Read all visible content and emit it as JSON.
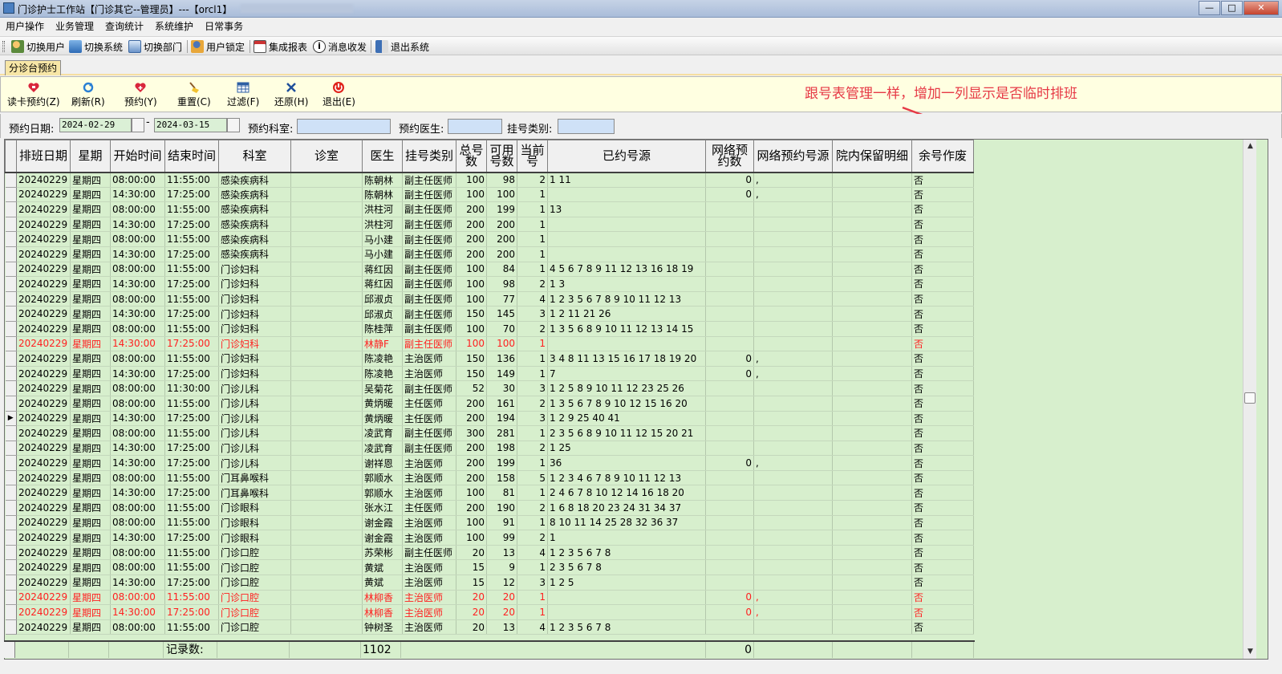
{
  "window": {
    "title": "门诊护士工作站【门诊其它--管理员】---【orcl1】",
    "buttons": {
      "minimize": "—",
      "maximize": "□",
      "close": "✕"
    }
  },
  "menu": [
    "用户操作",
    "业务管理",
    "查询统计",
    "系统维护",
    "日常事务"
  ],
  "toolbar": {
    "switch_user": "切换用户",
    "switch_system": "切换系统",
    "switch_dept": "切换部门",
    "user_lock": "用户锁定",
    "integrated_report": "集成报表",
    "messages": "消息收发",
    "exit_system": "退出系统"
  },
  "tab": {
    "label": "分诊台预约"
  },
  "actions": {
    "read_card": "读卡预约(Z)",
    "refresh": "刷新(R)",
    "reserve": "预约(Y)",
    "reset": "重置(C)",
    "filter": "过滤(F)",
    "restore": "还原(H)",
    "exit": "退出(E)"
  },
  "annotation": {
    "text": "跟号表管理一样，增加一列显示是否临时排班",
    "color": "#e63946"
  },
  "filters": {
    "date_label": "预约日期:",
    "date_from": "2024-02-29",
    "date_sep": "-",
    "date_to": "2024-03-15",
    "dept_label": "预约科室:",
    "dept_value": "",
    "doctor_label": "预约医生:",
    "doctor_value": "",
    "type_label": "挂号类别:",
    "type_value": ""
  },
  "grid": {
    "columns": [
      "排班日期",
      "星期",
      "开始时间",
      "结束时间",
      "科室",
      "诊室",
      "医生",
      "挂号类别",
      "总号数",
      "可用号数",
      "当前号",
      "已约号源",
      "网络预约数",
      "网络预约号源",
      "院内保留明细",
      "余号作废"
    ],
    "rows": [
      {
        "date": "20240229",
        "week": "星期四",
        "start": "08:00:00",
        "end": "11:55:00",
        "dept": "感染疾病科",
        "room": "",
        "doctor": "陈朝林",
        "type": "副主任医师",
        "total": "100",
        "avail": "98",
        "cur": "2",
        "booked": "1 11",
        "net": "0",
        "netsrc": ",",
        "reserve": "",
        "void": "否",
        "red": false,
        "current": false
      },
      {
        "date": "20240229",
        "week": "星期四",
        "start": "14:30:00",
        "end": "17:25:00",
        "dept": "感染疾病科",
        "room": "",
        "doctor": "陈朝林",
        "type": "副主任医师",
        "total": "100",
        "avail": "100",
        "cur": "1",
        "booked": "",
        "net": "0",
        "netsrc": ",",
        "reserve": "",
        "void": "否",
        "red": false,
        "current": false
      },
      {
        "date": "20240229",
        "week": "星期四",
        "start": "08:00:00",
        "end": "11:55:00",
        "dept": "感染疾病科",
        "room": "",
        "doctor": "洪柱河",
        "type": "副主任医师",
        "total": "200",
        "avail": "199",
        "cur": "1",
        "booked": "13",
        "net": "",
        "netsrc": "",
        "reserve": "",
        "void": "否",
        "red": false,
        "current": false
      },
      {
        "date": "20240229",
        "week": "星期四",
        "start": "14:30:00",
        "end": "17:25:00",
        "dept": "感染疾病科",
        "room": "",
        "doctor": "洪柱河",
        "type": "副主任医师",
        "total": "200",
        "avail": "200",
        "cur": "1",
        "booked": "",
        "net": "",
        "netsrc": "",
        "reserve": "",
        "void": "否",
        "red": false,
        "current": false
      },
      {
        "date": "20240229",
        "week": "星期四",
        "start": "08:00:00",
        "end": "11:55:00",
        "dept": "感染疾病科",
        "room": "",
        "doctor": "马小建",
        "type": "副主任医师",
        "total": "200",
        "avail": "200",
        "cur": "1",
        "booked": "",
        "net": "",
        "netsrc": "",
        "reserve": "",
        "void": "否",
        "red": false,
        "current": false
      },
      {
        "date": "20240229",
        "week": "星期四",
        "start": "14:30:00",
        "end": "17:25:00",
        "dept": "感染疾病科",
        "room": "",
        "doctor": "马小建",
        "type": "副主任医师",
        "total": "200",
        "avail": "200",
        "cur": "1",
        "booked": "",
        "net": "",
        "netsrc": "",
        "reserve": "",
        "void": "否",
        "red": false,
        "current": false
      },
      {
        "date": "20240229",
        "week": "星期四",
        "start": "08:00:00",
        "end": "11:55:00",
        "dept": "门诊妇科",
        "room": "",
        "doctor": "蒋红因",
        "type": "副主任医师",
        "total": "100",
        "avail": "84",
        "cur": "1",
        "booked": "4 5 6 7 8 9 11 12 13 16 18 19",
        "net": "",
        "netsrc": "",
        "reserve": "",
        "void": "否",
        "red": false,
        "current": false
      },
      {
        "date": "20240229",
        "week": "星期四",
        "start": "14:30:00",
        "end": "17:25:00",
        "dept": "门诊妇科",
        "room": "",
        "doctor": "蒋红因",
        "type": "副主任医师",
        "total": "100",
        "avail": "98",
        "cur": "2",
        "booked": "1 3",
        "net": "",
        "netsrc": "",
        "reserve": "",
        "void": "否",
        "red": false,
        "current": false
      },
      {
        "date": "20240229",
        "week": "星期四",
        "start": "08:00:00",
        "end": "11:55:00",
        "dept": "门诊妇科",
        "room": "",
        "doctor": "邱淑贞",
        "type": "副主任医师",
        "total": "100",
        "avail": "77",
        "cur": "4",
        "booked": "1 2 3 5 6 7 8 9 10 11 12 13",
        "net": "",
        "netsrc": "",
        "reserve": "",
        "void": "否",
        "red": false,
        "current": false
      },
      {
        "date": "20240229",
        "week": "星期四",
        "start": "14:30:00",
        "end": "17:25:00",
        "dept": "门诊妇科",
        "room": "",
        "doctor": "邱淑贞",
        "type": "副主任医师",
        "total": "150",
        "avail": "145",
        "cur": "3",
        "booked": "1 2 11 21 26",
        "net": "",
        "netsrc": "",
        "reserve": "",
        "void": "否",
        "red": false,
        "current": false
      },
      {
        "date": "20240229",
        "week": "星期四",
        "start": "08:00:00",
        "end": "11:55:00",
        "dept": "门诊妇科",
        "room": "",
        "doctor": "陈桂萍",
        "type": "副主任医师",
        "total": "100",
        "avail": "70",
        "cur": "2",
        "booked": "1 3 5 6 8 9 10 11 12 13 14 15",
        "net": "",
        "netsrc": "",
        "reserve": "",
        "void": "否",
        "red": false,
        "current": false
      },
      {
        "date": "20240229",
        "week": "星期四",
        "start": "14:30:00",
        "end": "17:25:00",
        "dept": "门诊妇科",
        "room": "",
        "doctor": "林静F",
        "type": "副主任医师",
        "total": "100",
        "avail": "100",
        "cur": "1",
        "booked": "",
        "net": "",
        "netsrc": "",
        "reserve": "",
        "void": "否",
        "red": true,
        "current": false
      },
      {
        "date": "20240229",
        "week": "星期四",
        "start": "08:00:00",
        "end": "11:55:00",
        "dept": "门诊妇科",
        "room": "",
        "doctor": "陈凌艳",
        "type": "主治医师",
        "total": "150",
        "avail": "136",
        "cur": "1",
        "booked": "3 4 8 11 13 15 16 17 18 19 20",
        "net": "0",
        "netsrc": ",",
        "reserve": "",
        "void": "否",
        "red": false,
        "current": false
      },
      {
        "date": "20240229",
        "week": "星期四",
        "start": "14:30:00",
        "end": "17:25:00",
        "dept": "门诊妇科",
        "room": "",
        "doctor": "陈凌艳",
        "type": "主治医师",
        "total": "150",
        "avail": "149",
        "cur": "1",
        "booked": "7",
        "net": "0",
        "netsrc": ",",
        "reserve": "",
        "void": "否",
        "red": false,
        "current": false
      },
      {
        "date": "20240229",
        "week": "星期四",
        "start": "08:00:00",
        "end": "11:30:00",
        "dept": "门诊儿科",
        "room": "",
        "doctor": "吴菊花",
        "type": "副主任医师",
        "total": "52",
        "avail": "30",
        "cur": "3",
        "booked": "1 2 5 8 9 10 11 12 23 25 26",
        "net": "",
        "netsrc": "",
        "reserve": "",
        "void": "否",
        "red": false,
        "current": false
      },
      {
        "date": "20240229",
        "week": "星期四",
        "start": "08:00:00",
        "end": "11:55:00",
        "dept": "门诊儿科",
        "room": "",
        "doctor": "黄炳暖",
        "type": "主任医师",
        "total": "200",
        "avail": "161",
        "cur": "2",
        "booked": "1 3 5 6 7 8 9 10 12 15 16 20",
        "net": "",
        "netsrc": "",
        "reserve": "",
        "void": "否",
        "red": false,
        "current": false
      },
      {
        "date": "20240229",
        "week": "星期四",
        "start": "14:30:00",
        "end": "17:25:00",
        "dept": "门诊儿科",
        "room": "",
        "doctor": "黄炳暖",
        "type": "主任医师",
        "total": "200",
        "avail": "194",
        "cur": "3",
        "booked": "1 2 9 25 40 41",
        "net": "",
        "netsrc": "",
        "reserve": "",
        "void": "否",
        "red": false,
        "current": true
      },
      {
        "date": "20240229",
        "week": "星期四",
        "start": "08:00:00",
        "end": "11:55:00",
        "dept": "门诊儿科",
        "room": "",
        "doctor": "凌武育",
        "type": "副主任医师",
        "total": "300",
        "avail": "281",
        "cur": "1",
        "booked": "2 3 5 6 8 9 10 11 12 15 20 21",
        "net": "",
        "netsrc": "",
        "reserve": "",
        "void": "否",
        "red": false,
        "current": false
      },
      {
        "date": "20240229",
        "week": "星期四",
        "start": "14:30:00",
        "end": "17:25:00",
        "dept": "门诊儿科",
        "room": "",
        "doctor": "凌武育",
        "type": "副主任医师",
        "total": "200",
        "avail": "198",
        "cur": "2",
        "booked": "1 25",
        "net": "",
        "netsrc": "",
        "reserve": "",
        "void": "否",
        "red": false,
        "current": false
      },
      {
        "date": "20240229",
        "week": "星期四",
        "start": "14:30:00",
        "end": "17:25:00",
        "dept": "门诊儿科",
        "room": "",
        "doctor": "谢祥恩",
        "type": "主治医师",
        "total": "200",
        "avail": "199",
        "cur": "1",
        "booked": "36",
        "net": "0",
        "netsrc": ",",
        "reserve": "",
        "void": "否",
        "red": false,
        "current": false
      },
      {
        "date": "20240229",
        "week": "星期四",
        "start": "08:00:00",
        "end": "11:55:00",
        "dept": "门耳鼻喉科",
        "room": "",
        "doctor": "郭顺水",
        "type": "主治医师",
        "total": "200",
        "avail": "158",
        "cur": "5",
        "booked": "1 2 3 4 6 7 8 9 10 11 12 13",
        "net": "",
        "netsrc": "",
        "reserve": "",
        "void": "否",
        "red": false,
        "current": false
      },
      {
        "date": "20240229",
        "week": "星期四",
        "start": "14:30:00",
        "end": "17:25:00",
        "dept": "门耳鼻喉科",
        "room": "",
        "doctor": "郭顺水",
        "type": "主治医师",
        "total": "100",
        "avail": "81",
        "cur": "1",
        "booked": "2 4 6 7 8 10 12 14 16 18 20",
        "net": "",
        "netsrc": "",
        "reserve": "",
        "void": "否",
        "red": false,
        "current": false
      },
      {
        "date": "20240229",
        "week": "星期四",
        "start": "08:00:00",
        "end": "11:55:00",
        "dept": "门诊眼科",
        "room": "",
        "doctor": "张水江",
        "type": "主任医师",
        "total": "200",
        "avail": "190",
        "cur": "2",
        "booked": "1 6 8 18 20 23 24 31 34 37",
        "net": "",
        "netsrc": "",
        "reserve": "",
        "void": "否",
        "red": false,
        "current": false
      },
      {
        "date": "20240229",
        "week": "星期四",
        "start": "08:00:00",
        "end": "11:55:00",
        "dept": "门诊眼科",
        "room": "",
        "doctor": "谢金霞",
        "type": "主治医师",
        "total": "100",
        "avail": "91",
        "cur": "1",
        "booked": "8 10 11 14 25 28 32 36 37",
        "net": "",
        "netsrc": "",
        "reserve": "",
        "void": "否",
        "red": false,
        "current": false
      },
      {
        "date": "20240229",
        "week": "星期四",
        "start": "14:30:00",
        "end": "17:25:00",
        "dept": "门诊眼科",
        "room": "",
        "doctor": "谢金霞",
        "type": "主治医师",
        "total": "100",
        "avail": "99",
        "cur": "2",
        "booked": "1",
        "net": "",
        "netsrc": "",
        "reserve": "",
        "void": "否",
        "red": false,
        "current": false
      },
      {
        "date": "20240229",
        "week": "星期四",
        "start": "08:00:00",
        "end": "11:55:00",
        "dept": "门诊口腔",
        "room": "",
        "doctor": "苏荣彬",
        "type": "副主任医师",
        "total": "20",
        "avail": "13",
        "cur": "4",
        "booked": "1 2 3 5 6 7 8",
        "net": "",
        "netsrc": "",
        "reserve": "",
        "void": "否",
        "red": false,
        "current": false
      },
      {
        "date": "20240229",
        "week": "星期四",
        "start": "08:00:00",
        "end": "11:55:00",
        "dept": "门诊口腔",
        "room": "",
        "doctor": "黄斌",
        "type": "主治医师",
        "total": "15",
        "avail": "9",
        "cur": "1",
        "booked": "2 3 5 6 7 8",
        "net": "",
        "netsrc": "",
        "reserve": "",
        "void": "否",
        "red": false,
        "current": false
      },
      {
        "date": "20240229",
        "week": "星期四",
        "start": "14:30:00",
        "end": "17:25:00",
        "dept": "门诊口腔",
        "room": "",
        "doctor": "黄斌",
        "type": "主治医师",
        "total": "15",
        "avail": "12",
        "cur": "3",
        "booked": "1 2 5",
        "net": "",
        "netsrc": "",
        "reserve": "",
        "void": "否",
        "red": false,
        "current": false
      },
      {
        "date": "20240229",
        "week": "星期四",
        "start": "08:00:00",
        "end": "11:55:00",
        "dept": "门诊口腔",
        "room": "",
        "doctor": "林柳香",
        "type": "主治医师",
        "total": "20",
        "avail": "20",
        "cur": "1",
        "booked": "",
        "net": "0",
        "netsrc": ",",
        "reserve": "",
        "void": "否",
        "red": true,
        "current": false
      },
      {
        "date": "20240229",
        "week": "星期四",
        "start": "14:30:00",
        "end": "17:25:00",
        "dept": "门诊口腔",
        "room": "",
        "doctor": "林柳香",
        "type": "主治医师",
        "total": "20",
        "avail": "20",
        "cur": "1",
        "booked": "",
        "net": "0",
        "netsrc": ",",
        "reserve": "",
        "void": "否",
        "red": true,
        "current": false
      },
      {
        "date": "20240229",
        "week": "星期四",
        "start": "08:00:00",
        "end": "11:55:00",
        "dept": "门诊口腔",
        "room": "",
        "doctor": "钟树圣",
        "type": "主治医师",
        "total": "20",
        "avail": "13",
        "cur": "4",
        "booked": "1 2 3 5 6 7 8",
        "net": "",
        "netsrc": "",
        "reserve": "",
        "void": "否",
        "red": false,
        "current": false
      }
    ],
    "footer": {
      "label": "记录数:",
      "count": "1102",
      "net_total": "0"
    }
  }
}
